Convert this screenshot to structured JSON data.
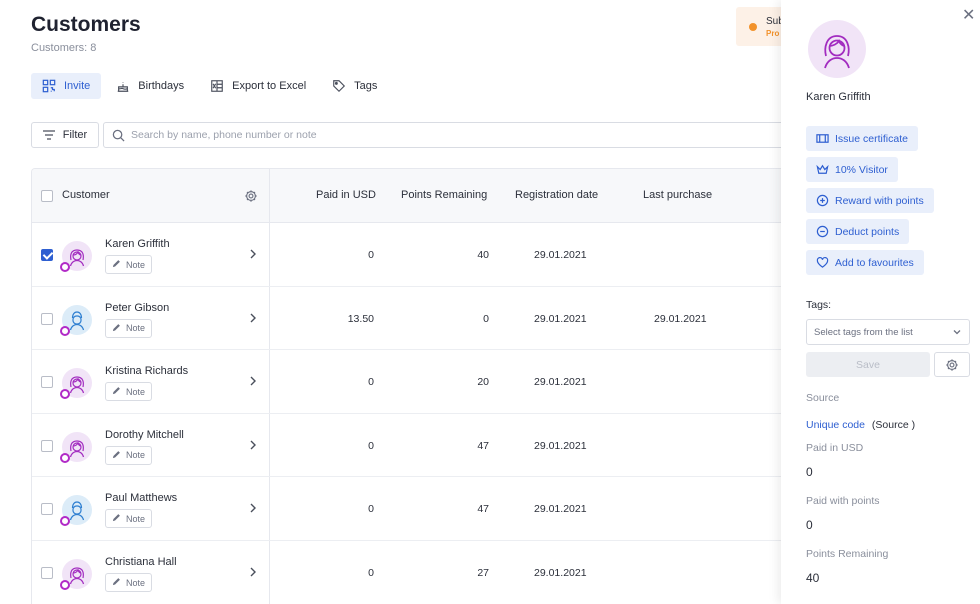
{
  "header": {
    "title": "Customers",
    "subtitle": "Customers: 8"
  },
  "status": {
    "line1": "Sub",
    "line2": "Pro",
    "color": "#f2922b"
  },
  "toolbar": [
    {
      "label": "Invite",
      "icon": "qr-code-icon",
      "active": true
    },
    {
      "label": "Birthdays",
      "icon": "cake-icon",
      "active": false
    },
    {
      "label": "Export to Excel",
      "icon": "excel-icon",
      "active": false
    },
    {
      "label": "Tags",
      "icon": "tag-icon",
      "active": false
    }
  ],
  "filter": {
    "label": "Filter"
  },
  "search": {
    "placeholder": "Search by name, phone number or note"
  },
  "table": {
    "columns": [
      "Customer",
      "Paid in USD",
      "Points Remaining",
      "Registration date",
      "Last purchase"
    ],
    "note_label": "Note",
    "rows": [
      {
        "name": "Karen Griffith",
        "gender": "f",
        "checked": true,
        "paid": "0",
        "points": "40",
        "reg": "29.01.2021",
        "last": ""
      },
      {
        "name": "Peter Gibson",
        "gender": "m",
        "checked": false,
        "paid": "13.50",
        "points": "0",
        "reg": "29.01.2021",
        "last": "29.01.2021"
      },
      {
        "name": "Kristina Richards",
        "gender": "f",
        "checked": false,
        "paid": "0",
        "points": "20",
        "reg": "29.01.2021",
        "last": ""
      },
      {
        "name": "Dorothy Mitchell",
        "gender": "f",
        "checked": false,
        "paid": "0",
        "points": "47",
        "reg": "29.01.2021",
        "last": ""
      },
      {
        "name": "Paul Matthews",
        "gender": "m",
        "checked": false,
        "paid": "0",
        "points": "47",
        "reg": "29.01.2021",
        "last": ""
      },
      {
        "name": "Christiana Hall",
        "gender": "f",
        "checked": false,
        "paid": "0",
        "points": "27",
        "reg": "29.01.2021",
        "last": ""
      }
    ]
  },
  "panel": {
    "name": "Karen Griffith",
    "actions": [
      {
        "label": "Issue certificate",
        "icon": "certificate-icon"
      },
      {
        "label": "10% Visitor",
        "icon": "crown-icon"
      },
      {
        "label": "Reward with points",
        "icon": "plus-circle-icon"
      },
      {
        "label": "Deduct points",
        "icon": "minus-circle-icon"
      },
      {
        "label": "Add to favourites",
        "icon": "heart-icon"
      }
    ],
    "tags_label": "Tags:",
    "tags_placeholder": "Select tags from the list",
    "save_label": "Save",
    "source_label": "Source",
    "source_link": "Unique code",
    "source_value": "(Source )",
    "paid_label": "Paid in USD",
    "paid_value": "0",
    "paid_points_label": "Paid with points",
    "paid_points_value": "0",
    "remaining_label": "Points Remaining",
    "remaining_value": "40"
  },
  "colors": {
    "accent": "#2e5fd1",
    "accent_bg": "#e9effb",
    "badge": "#b12ac7"
  }
}
